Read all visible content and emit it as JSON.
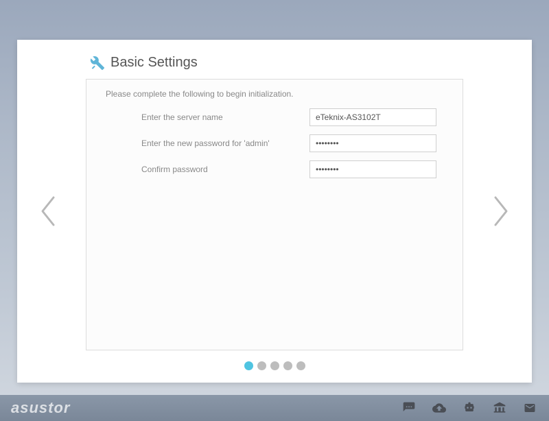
{
  "title": "Basic Settings",
  "instruction": "Please complete the following to begin initialization.",
  "fields": {
    "server_name": {
      "label": "Enter the server name",
      "value": "eTeknix-AS3102T"
    },
    "password": {
      "label": "Enter the new password for 'admin'",
      "value": "••••••••"
    },
    "confirm": {
      "label": "Confirm password",
      "value": "••••••••"
    }
  },
  "pager": {
    "total": 5,
    "current": 0
  },
  "brand": "asustor"
}
